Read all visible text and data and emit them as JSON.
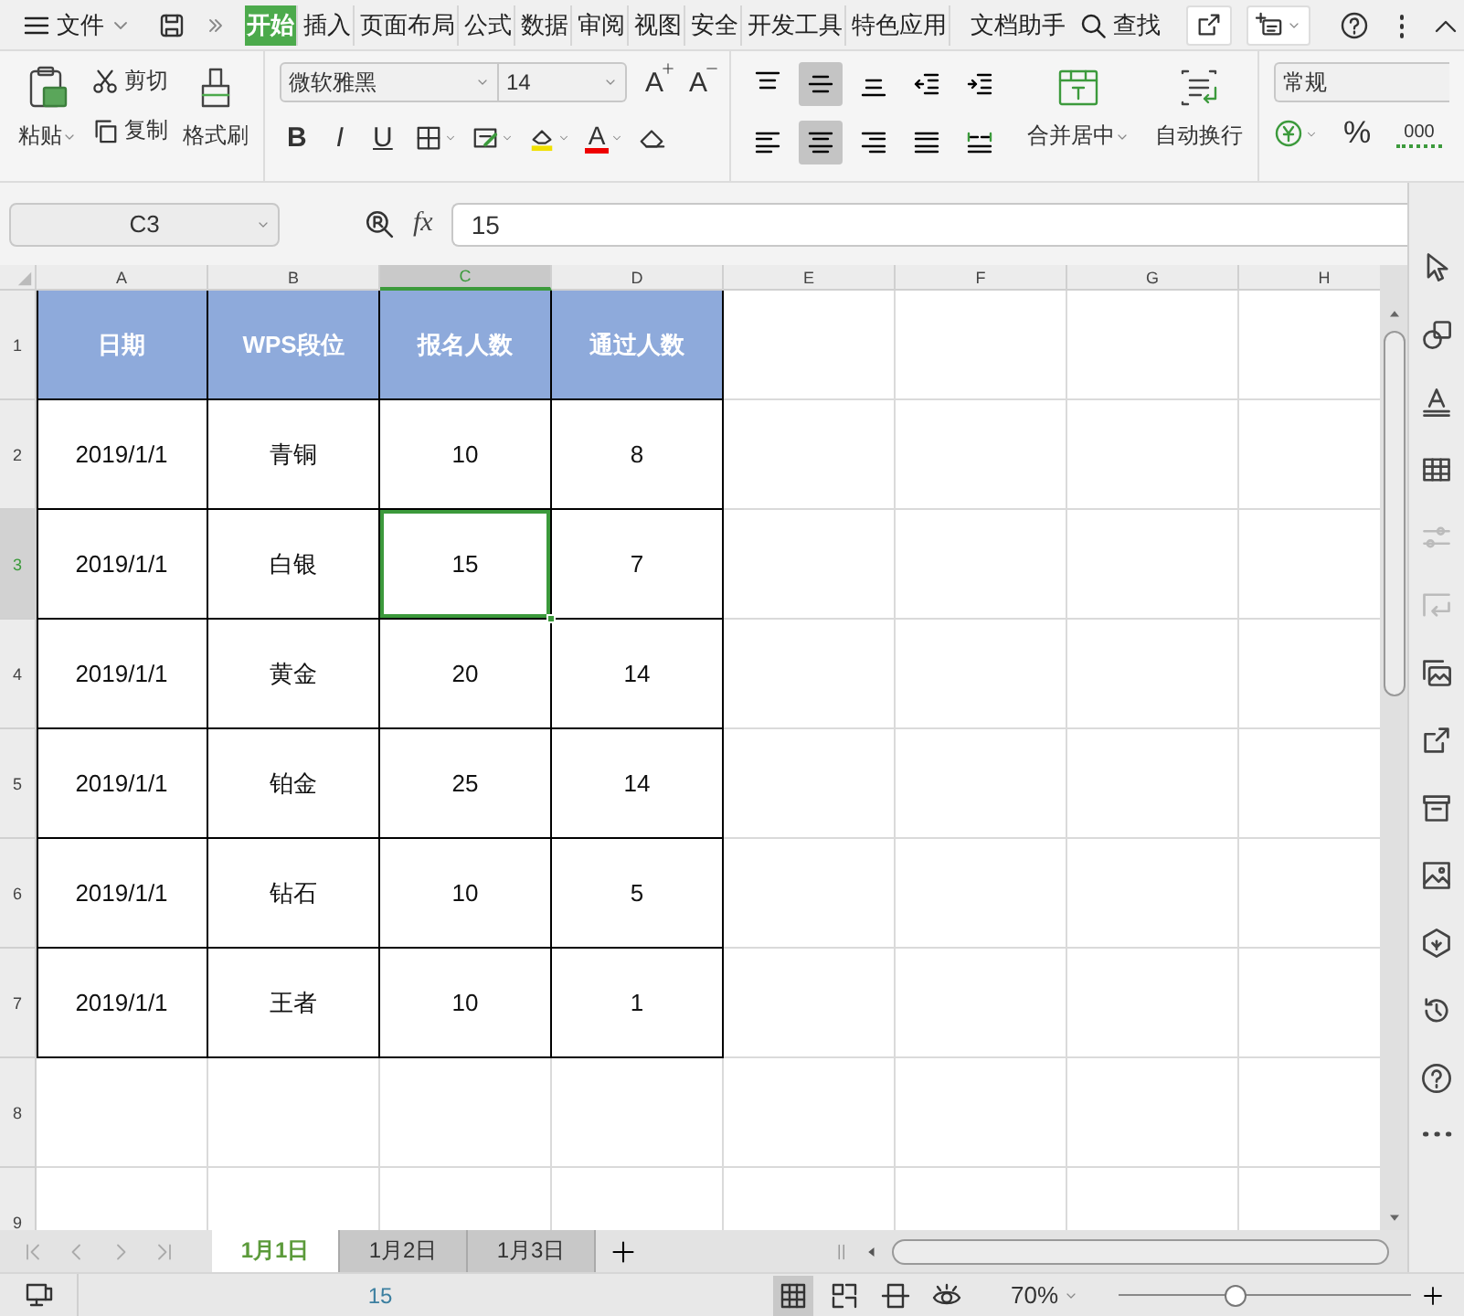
{
  "menu": {
    "file_label": "文件",
    "tabs": [
      {
        "label": "开始",
        "selected": true
      },
      {
        "label": "插入",
        "selected": false
      },
      {
        "label": "页面布局",
        "selected": false
      },
      {
        "label": "公式",
        "selected": false
      },
      {
        "label": "数据",
        "selected": false
      },
      {
        "label": "审阅",
        "selected": false
      },
      {
        "label": "视图",
        "selected": false
      },
      {
        "label": "安全",
        "selected": false
      },
      {
        "label": "开发工具",
        "selected": false
      },
      {
        "label": "特色应用",
        "selected": false
      },
      {
        "label": "文档助手",
        "selected": false
      }
    ],
    "search_label": "查找"
  },
  "ribbon": {
    "clipboard": {
      "paste": "粘贴",
      "cut": "剪切",
      "copy": "复制",
      "painter": "格式刷"
    },
    "font": {
      "name": "微软雅黑",
      "size": "14",
      "grow": "A",
      "shrink": "A",
      "styles": [
        "B",
        "I",
        "U"
      ],
      "color_label": "A"
    },
    "alignment": {
      "buttons": [
        {
          "kind": "top",
          "selected": false
        },
        {
          "kind": "middle",
          "selected": true
        },
        {
          "kind": "bottom",
          "selected": false
        },
        {
          "kind": "outdent",
          "selected": false
        },
        {
          "kind": "indent",
          "selected": false
        },
        {
          "kind": "left",
          "selected": false
        },
        {
          "kind": "center",
          "selected": true
        },
        {
          "kind": "right",
          "selected": false
        },
        {
          "kind": "justify",
          "selected": false
        },
        {
          "kind": "distribute",
          "selected": false
        }
      ],
      "merge": "合并居中",
      "wrap": "自动换行"
    },
    "number": {
      "format": "常规",
      "percent": "%",
      "thousands": "000"
    }
  },
  "formula_bar": {
    "cell": "C3",
    "function_label": "fx",
    "value": "15"
  },
  "sheet": {
    "columns": [
      {
        "label": "A",
        "selected": false
      },
      {
        "label": "B",
        "selected": false
      },
      {
        "label": "C",
        "selected": true
      },
      {
        "label": "D",
        "selected": false
      },
      {
        "label": "E",
        "selected": false
      },
      {
        "label": "F",
        "selected": false
      },
      {
        "label": "G",
        "selected": false
      },
      {
        "label": "H",
        "selected": false
      }
    ],
    "rows": [
      {
        "label": "1",
        "selected": false,
        "kind": "header",
        "cells": [
          {
            "text": "日期",
            "selected": false
          },
          {
            "text": "WPS段位",
            "selected": false
          },
          {
            "text": "报名人数",
            "selected": false
          },
          {
            "text": "通过人数",
            "selected": false
          }
        ]
      },
      {
        "label": "2",
        "selected": false,
        "kind": "data",
        "cells": [
          {
            "text": "2019/1/1",
            "selected": false
          },
          {
            "text": "青铜",
            "selected": false
          },
          {
            "text": "10",
            "selected": false
          },
          {
            "text": "8",
            "selected": false
          }
        ]
      },
      {
        "label": "3",
        "selected": true,
        "kind": "data",
        "cells": [
          {
            "text": "2019/1/1",
            "selected": false
          },
          {
            "text": "白银",
            "selected": false
          },
          {
            "text": "15",
            "selected": true
          },
          {
            "text": "7",
            "selected": false
          }
        ]
      },
      {
        "label": "4",
        "selected": false,
        "kind": "data",
        "cells": [
          {
            "text": "2019/1/1",
            "selected": false
          },
          {
            "text": "黄金",
            "selected": false
          },
          {
            "text": "20",
            "selected": false
          },
          {
            "text": "14",
            "selected": false
          }
        ]
      },
      {
        "label": "5",
        "selected": false,
        "kind": "data",
        "cells": [
          {
            "text": "2019/1/1",
            "selected": false
          },
          {
            "text": "铂金",
            "selected": false
          },
          {
            "text": "25",
            "selected": false
          },
          {
            "text": "14",
            "selected": false
          }
        ]
      },
      {
        "label": "6",
        "selected": false,
        "kind": "data",
        "cells": [
          {
            "text": "2019/1/1",
            "selected": false
          },
          {
            "text": "钻石",
            "selected": false
          },
          {
            "text": "10",
            "selected": false
          },
          {
            "text": "5",
            "selected": false
          }
        ]
      },
      {
        "label": "7",
        "selected": false,
        "kind": "data",
        "cells": [
          {
            "text": "2019/1/1",
            "selected": false
          },
          {
            "text": "王者",
            "selected": false
          },
          {
            "text": "10",
            "selected": false
          },
          {
            "text": "1",
            "selected": false
          }
        ]
      },
      {
        "label": "8",
        "selected": false,
        "kind": "empty"
      },
      {
        "label": "9",
        "selected": false,
        "kind": "empty"
      }
    ]
  },
  "sheet_tabs": [
    {
      "label": "1月1日",
      "selected": true
    },
    {
      "label": "1月2日",
      "selected": false
    },
    {
      "label": "1月3日",
      "selected": false
    }
  ],
  "sidebar_tools": [
    {
      "kind": "pointer",
      "disabled": false
    },
    {
      "kind": "shapes",
      "disabled": false
    },
    {
      "kind": "text-style",
      "disabled": false
    },
    {
      "kind": "table",
      "disabled": false
    },
    {
      "kind": "sliders",
      "disabled": true
    },
    {
      "kind": "transfer",
      "disabled": true
    },
    {
      "kind": "gallery",
      "disabled": false
    },
    {
      "kind": "share",
      "disabled": false
    },
    {
      "kind": "archive",
      "disabled": false
    },
    {
      "kind": "image",
      "disabled": false
    },
    {
      "kind": "hexagon",
      "disabled": false
    },
    {
      "kind": "history",
      "disabled": false
    },
    {
      "kind": "help",
      "disabled": false
    },
    {
      "kind": "more",
      "disabled": false
    }
  ],
  "status_bar": {
    "value": "15",
    "views": [
      {
        "kind": "normal",
        "selected": true
      },
      {
        "kind": "page-break",
        "selected": false
      },
      {
        "kind": "layout",
        "selected": false
      },
      {
        "kind": "eye",
        "selected": false
      }
    ],
    "zoom": "70%",
    "zoom_slider": {
      "level": 0.4
    }
  }
}
